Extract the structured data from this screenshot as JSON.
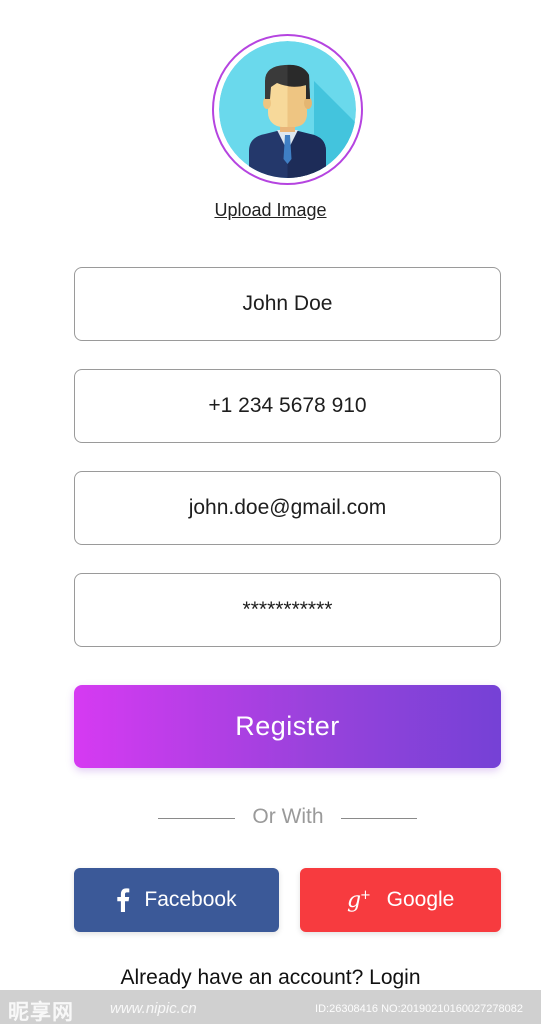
{
  "profile": {
    "upload_label": "Upload Image"
  },
  "form": {
    "name_value": "John Doe",
    "phone_value": "+1 234 5678 910",
    "email_value": "john.doe@gmail.com",
    "password_value": "***********"
  },
  "register": {
    "label": "Register"
  },
  "divider": {
    "label": "Or With"
  },
  "social": {
    "facebook_label": "Facebook",
    "facebook_icon": "facebook-icon",
    "google_label": "Google",
    "google_icon": "google-plus-icon"
  },
  "footer": {
    "prompt": "Already have an account?",
    "login_label": "Login"
  },
  "watermark": {
    "logo_text": "昵享网",
    "url": "www.nipic.cn",
    "id_text": "ID:26308416 NO:20190210160027278082"
  },
  "colors": {
    "gradient_start": "#d63af2",
    "gradient_end": "#7541d6",
    "facebook": "#3b5998",
    "google": "#f73b3f",
    "avatar_ring": "#b544e0",
    "avatar_bg": "#6ad9ec"
  }
}
